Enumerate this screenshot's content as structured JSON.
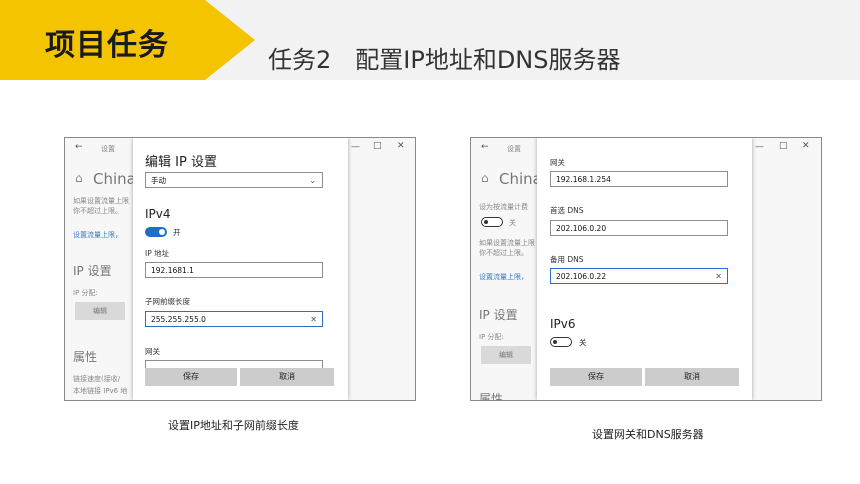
{
  "header": {
    "tag": "项目任务",
    "title": "任务2　配置IP地址和DNS服务器"
  },
  "left_window": {
    "back_icon": "←",
    "settings_label": "设置",
    "minimize_icon": "—",
    "maximize_icon": "□",
    "close_icon": "✕",
    "bg": {
      "network_name": "China",
      "desc_line1": "如果设置流量上限",
      "desc_line2": "你不超过上限。",
      "link": "设置流量上限，",
      "ip_settings": "IP 设置",
      "ip_assign": "IP 分配:",
      "edit_btn": "编辑",
      "properties": "属性",
      "prop_line1": "链接速度(接收/",
      "prop_line2": "本地链接 IPv6 地"
    },
    "dialog": {
      "title": "编辑 IP 设置",
      "mode_value": "手动",
      "ipv4": "IPv4",
      "toggle_label": "开",
      "ip_label": "IP 地址",
      "ip_value": "192.1681.1",
      "prefix_label": "子网前缀长度",
      "prefix_value": "255.255.255.0",
      "gateway_label": "网关",
      "save": "保存",
      "cancel": "取消"
    }
  },
  "right_window": {
    "back_icon": "←",
    "settings_label": "设置",
    "minimize_icon": "—",
    "maximize_icon": "□",
    "close_icon": "✕",
    "bg": {
      "network_name": "China",
      "metered_line": "设为按流量计费",
      "toggle_label": "关",
      "desc_line1": "如果设置流量上限",
      "desc_line2": "你不超过上限。",
      "link": "设置流量上限，",
      "ip_settings": "IP 设置",
      "ip_assign": "IP 分配:",
      "edit_btn": "编辑",
      "properties": "属性"
    },
    "dialog": {
      "gateway_label": "网关",
      "gateway_value": "192.168.1.254",
      "dns1_label": "首选 DNS",
      "dns1_value": "202.106.0.20",
      "dns2_label": "备用 DNS",
      "dns2_value": "202.106.0.22",
      "ipv6": "IPv6",
      "toggle_label": "关",
      "save": "保存",
      "cancel": "取消"
    }
  },
  "captions": {
    "left": "设置IP地址和子网前缀长度",
    "right": "设置网关和DNS服务器"
  }
}
